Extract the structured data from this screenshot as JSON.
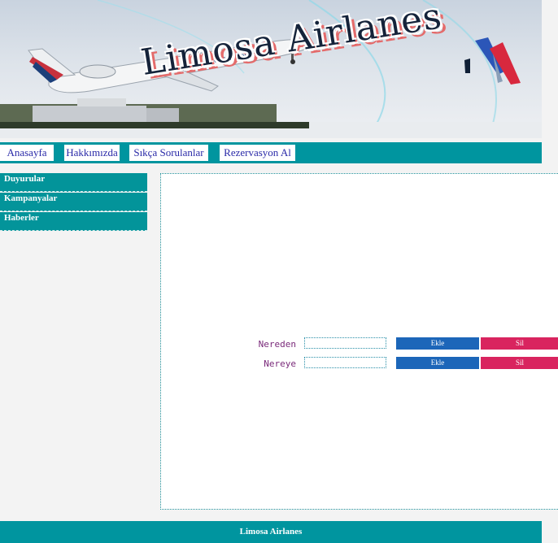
{
  "header": {
    "brand_title": "Limosa Airlanes",
    "plane_livery": "American Eagle",
    "logo": "american-airlines-logo"
  },
  "nav": {
    "items": [
      {
        "label": "Anasayfa"
      },
      {
        "label": "Hakkımızda"
      },
      {
        "label": "Sıkça Sorulanlar"
      },
      {
        "label": "Rezervasyon Al"
      }
    ]
  },
  "sidebar": {
    "items": [
      {
        "label": "Duyurular"
      },
      {
        "label": "Kampanyalar"
      },
      {
        "label": "Haberler"
      }
    ]
  },
  "form": {
    "rows": [
      {
        "label": "Nereden",
        "value": "",
        "add_label": "Ekle",
        "delete_label": "Sil"
      },
      {
        "label": "Nereye",
        "value": "",
        "add_label": "Ekle",
        "delete_label": "Sil"
      }
    ]
  },
  "footer": {
    "text": "Limosa Airlanes"
  },
  "colors": {
    "teal": "#00959f",
    "add_button": "#1c66b9",
    "delete_button": "#d9245f",
    "label_purple": "#7a2a7a"
  }
}
